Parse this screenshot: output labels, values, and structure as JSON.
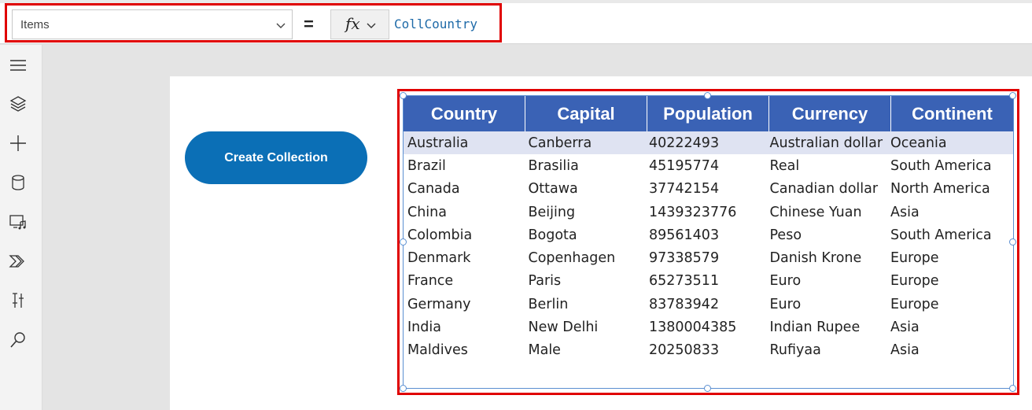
{
  "formula_bar": {
    "property": "Items",
    "equals": "=",
    "fx_label": "fx",
    "formula": "CollCountry"
  },
  "left_rail": {
    "icons": [
      "hamburger-menu-icon",
      "layers-icon",
      "add-icon",
      "data-icon",
      "media-icon",
      "power-automate-icon",
      "tools-icon",
      "search-icon"
    ]
  },
  "canvas": {
    "button_label": "Create Collection"
  },
  "table": {
    "headers": [
      "Country",
      "Capital",
      "Population",
      "Currency",
      "Continent"
    ],
    "rows": [
      [
        "Australia",
        "Canberra",
        "40222493",
        "Australian dollar",
        "Oceania"
      ],
      [
        "Brazil",
        "Brasilia",
        "45195774",
        "Real",
        "South America"
      ],
      [
        "Canada",
        "Ottawa",
        "37742154",
        "Canadian dollar",
        "North America"
      ],
      [
        "China",
        "Beijing",
        "1439323776",
        "Chinese Yuan",
        "Asia"
      ],
      [
        "Colombia",
        "Bogota",
        "89561403",
        "Peso",
        "South America"
      ],
      [
        "Denmark",
        "Copenhagen",
        "97338579",
        "Danish Krone",
        "Europe"
      ],
      [
        "France",
        "Paris",
        "65273511",
        "Euro",
        "Europe"
      ],
      [
        "Germany",
        "Berlin",
        "83783942",
        "Euro",
        "Europe"
      ],
      [
        "India",
        "New Delhi",
        "1380004385",
        "Indian Rupee",
        "Asia"
      ],
      [
        "Maldives",
        "Male",
        "20250833",
        "Rufiyaa",
        "Asia"
      ]
    ],
    "selected_row": 0
  },
  "colors": {
    "header_bg": "#3a62b5",
    "button_bg": "#0b6fb6",
    "highlight_border": "#e00000",
    "selected_row_bg": "#dfe3f2",
    "formula_text": "#1e6aa8"
  }
}
